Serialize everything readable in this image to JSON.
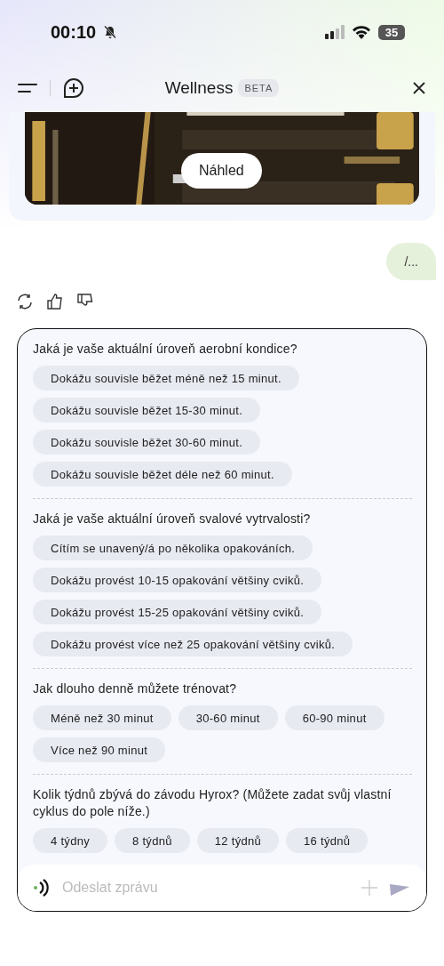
{
  "status_bar": {
    "time": "00:10",
    "battery": "35"
  },
  "header": {
    "title": "Wellness",
    "badge": "BETA"
  },
  "preview": {
    "kind": "picture",
    "button": "Náhled"
  },
  "user_message": {
    "text": "/..."
  },
  "survey": {
    "questions": [
      {
        "text": "Jaká je vaše aktuální úroveň aerobní kondice?",
        "options": [
          "Dokážu souvisle běžet méně než 15 minut.",
          "Dokážu souvisle běžet 15-30 minut.",
          "Dokážu souvisle běžet 30-60 minut.",
          "Dokážu souvisle běžet déle než 60 minut."
        ]
      },
      {
        "text": "Jaká je vaše aktuální úroveň svalové vytrvalosti?",
        "options": [
          "Cítím se unavený/á po několika opakováních.",
          "Dokážu provést 10-15 opakování většiny cviků.",
          "Dokážu provést 15-25 opakování většiny cviků.",
          "Dokážu provést více než 25 opakování většiny cviků."
        ]
      },
      {
        "text": "Jak dlouho denně můžete trénovat?",
        "options": [
          "Méně než 30 minut",
          "30-60 minut",
          "60-90 minut",
          "Více než 90 minut"
        ]
      },
      {
        "text": "Kolik týdnů zbývá do závodu Hyrox? (Můžete zadat svůj vlastní cyklus do pole níže.)",
        "options": [
          "4 týdny",
          "8 týdnů",
          "12 týdnů",
          "16 týdnů"
        ]
      }
    ]
  },
  "composer": {
    "placeholder": "Odeslat zprávu"
  }
}
